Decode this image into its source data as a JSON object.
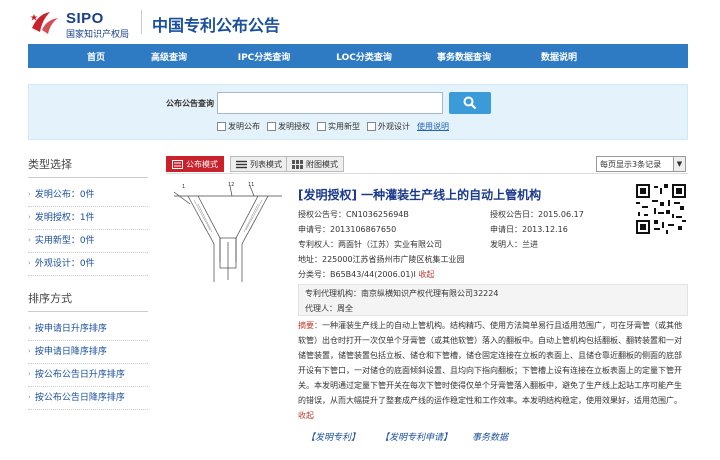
{
  "header": {
    "logo_text": "SIPO",
    "logo_sub": "国家知识产权局",
    "site_title": "中国专利公布公告"
  },
  "nav": {
    "items": [
      "首页",
      "高级查询",
      "IPC分类查询",
      "LOC分类查询",
      "事务数据查询",
      "数据说明"
    ]
  },
  "search": {
    "label": "公布公告查询",
    "value": "",
    "filters": [
      "发明公布",
      "发明授权",
      "实用新型",
      "外观设计"
    ],
    "usage_link": "使用说明"
  },
  "sidebar": {
    "type_heading": "类型选择",
    "type_items": [
      "发明公布：0件",
      "发明授权：1件",
      "实用新型：0件",
      "外观设计：0件"
    ],
    "sort_heading": "排序方式",
    "sort_items": [
      "按申请日升序排序",
      "按申请日降序排序",
      "按公布公告日升序排序",
      "按公布公告日降序排序"
    ]
  },
  "toolbar": {
    "tabs": [
      "公布模式",
      "列表模式",
      "附图模式"
    ],
    "per_page": "每页显示3条记录"
  },
  "result": {
    "title": "[发明授权] 一种灌装生产线上的自动上管机构",
    "grant_no_label": "授权公告号：",
    "grant_no": "CN103625694B",
    "grant_date_label": "授权公告日：",
    "grant_date": "2015.06.17",
    "app_no_label": "申请号：",
    "app_no": "2013106867650",
    "app_date_label": "申请日：",
    "app_date": "2013.12.16",
    "patentee_label": "专利权人：",
    "patentee": "两面针（江苏）实业有限公司",
    "inventor_label": "发明人：",
    "inventor": "兰进",
    "address_label": "地址：",
    "address": "225000江苏省扬州市广陵区杭集工业园",
    "class_label": "分类号：",
    "class_no": "B65B43/44(2006.01)I",
    "collapse": "收起",
    "agency_label": "专利代理机构：",
    "agency": "南京纵横知识产权代理有限公司32224",
    "agent_label": "代理人：",
    "agent": "周全",
    "abstract_label": "摘要：",
    "abstract": "一种灌装生产线上的自动上管机构。结构精巧、使用方法简单易行且适用范围广，可在牙膏管（或其他软管）出仓时打开一次仅单个牙膏管（或其他软管）落入的翻板中。自动上管机构包括翻板、翻转装置和一对储管装置，储管装置包括立板、储仓和下管槽，储仓固定连接在立板的表面上、且储仓靠近翻板的侧面的底部开设有下管口，一对储仓的底面倾斜设置、且均向下指向翻板；下管槽上设有连接在立板表面上的定量下管开关。本发明通过定量下管开关在每次下管时使得仅单个牙膏管落入翻板中，避免了生产线上起站工序可能产生的错误，从而大幅提升了整套成产线的运作稳定性和工作效率。本发明结构稳定，使用效果好，适用范围广。",
    "abstract_collapse": "收起",
    "links": [
      "【发明专利】",
      "【发明专利申请】",
      "事务数据"
    ]
  }
}
